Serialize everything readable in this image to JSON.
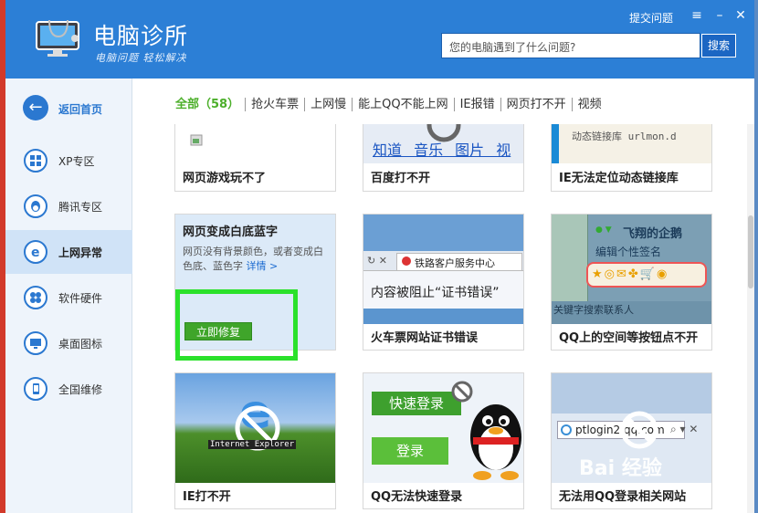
{
  "app": {
    "title": "电脑诊所",
    "slogan": "电脑问题 轻松解决",
    "header_link": "提交问题",
    "search_placeholder": "您的电脑遇到了什么问题?",
    "search_button": "搜索",
    "accent_color": "#2c7fd6"
  },
  "sidebar": {
    "back_label": "返回首页",
    "items": [
      {
        "label": "XP专区",
        "icon": "windows-icon"
      },
      {
        "label": "腾讯专区",
        "icon": "qq-penguin-icon"
      },
      {
        "label": "上网异常",
        "icon": "ie-icon",
        "active": true
      },
      {
        "label": "软件硬件",
        "icon": "puzzle-icon"
      },
      {
        "label": "桌面图标",
        "icon": "monitor-icon"
      },
      {
        "label": "全国维修",
        "icon": "phone-icon"
      }
    ]
  },
  "tabs": [
    "全部（58）",
    "抢火车票",
    "上网慢",
    "能上QQ不能上网",
    "IE报错",
    "网页打不开",
    "视频"
  ],
  "cards": [
    {
      "title": "网页游戏玩不了"
    },
    {
      "title": "百度打不开",
      "thumb_text": "知道 音乐 图片 视"
    },
    {
      "title": "IE无法定位动态链接库",
      "thumb_text": "动态链接库 urlmon.d"
    },
    {
      "title": "网页变成白底蓝字",
      "desc": "网页没有背景颜色，或者变成白色底、蓝色字",
      "detail_link": "详情 >",
      "fix_button": "立即修复"
    },
    {
      "title": "火车票网站证书错误",
      "thumb_tab": "铁路客户服务中心",
      "thumb_text": "内容被阻止“证书错误”"
    },
    {
      "title": "QQ上的空间等按钮点不开",
      "thumb_name": "飞翔的企鹅",
      "thumb_sign": "编辑个性签名",
      "thumb_search": "关键字搜索联系人"
    },
    {
      "title": "IE打不开",
      "thumb_text": "Internet Explorer"
    },
    {
      "title": "QQ无法快速登录",
      "thumb_btn1": "快速登录",
      "thumb_btn2": "登录"
    },
    {
      "title": "无法用QQ登录相关网站",
      "thumb_text": "ptlogin2.qq.com",
      "watermark": "Bai 经验"
    }
  ]
}
